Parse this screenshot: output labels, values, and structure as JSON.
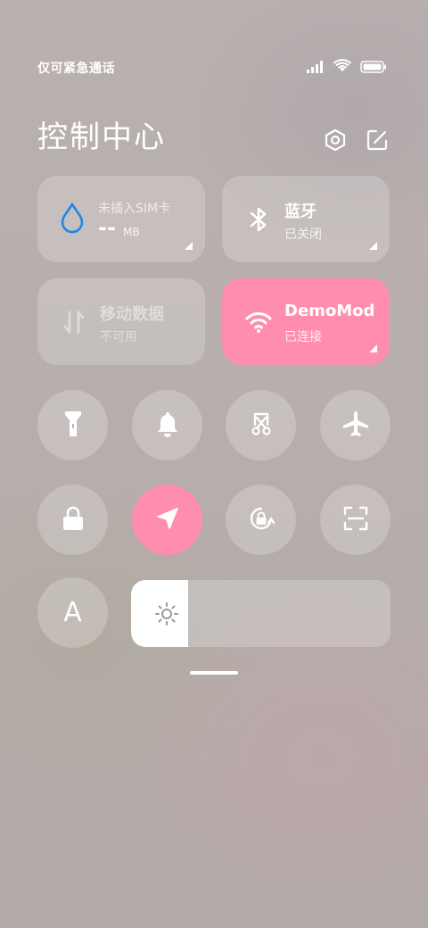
{
  "status_bar": {
    "carrier_text": "仅可紧急通话",
    "icons": [
      "signal-icon",
      "wifi-icon",
      "battery-icon"
    ]
  },
  "header": {
    "title": "控制中心",
    "icons": [
      "settings-hexagon-icon",
      "edit-icon"
    ]
  },
  "tiles": {
    "data_usage": {
      "title": "未插入SIM卡",
      "value": "--",
      "unit": "MB",
      "icon": "water-drop-icon"
    },
    "bluetooth": {
      "title": "蓝牙",
      "status": "已关闭",
      "icon": "bluetooth-icon"
    },
    "mobile_data": {
      "title": "移动数据",
      "status": "不可用",
      "icon": "data-arrows-icon"
    },
    "wifi": {
      "title": "DemoMod",
      "status": "已连接",
      "icon": "wifi-icon",
      "active_color": "#ff8eae"
    }
  },
  "toggles": {
    "row1": [
      "flashlight-icon",
      "bell-icon",
      "screenshot-scissors-icon",
      "airplane-icon"
    ],
    "row2": [
      "lock-icon",
      "location-arrow-icon",
      "auto-rotate-icon",
      "scan-icon"
    ],
    "location_active": true
  },
  "font_button": {
    "label": "A"
  },
  "brightness": {
    "level_percent": 22,
    "icon": "sun-icon"
  },
  "colors": {
    "accent": "#ff8eae",
    "drop_blue": "#1e88e5"
  }
}
